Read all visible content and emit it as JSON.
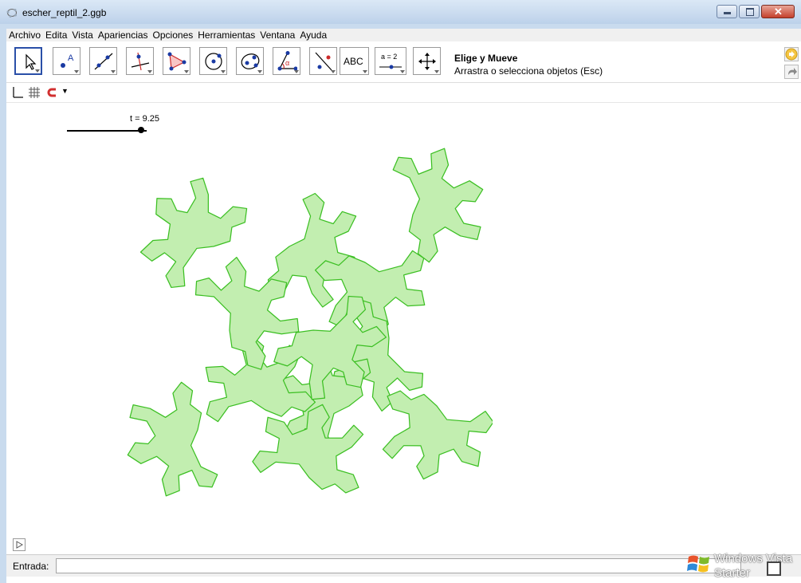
{
  "window": {
    "title": "escher_reptil_2.ggb"
  },
  "menu": [
    "Archivo",
    "Edita",
    "Vista",
    "Apariencias",
    "Opciones",
    "Herramientas",
    "Ventana",
    "Ayuda"
  ],
  "toolbar": {
    "tools": [
      "move",
      "point",
      "line",
      "perpendicular",
      "polygon",
      "circle",
      "conic",
      "angle",
      "reflect",
      "text",
      "slider",
      "move-graphics"
    ],
    "selected_tool_name": "Elige y Mueve",
    "selected_tool_help": "Arrastra o selecciona objetos (Esc)",
    "text_tool_label": "ABC",
    "slider_tool_label": "a = 2"
  },
  "graphics": {
    "slider_label": "t = 9.25",
    "slider_value": 9.25,
    "shape_fill": "#c2eeb0",
    "shape_stroke": "#3bbf22"
  },
  "input": {
    "label": "Entrada:",
    "value": ""
  },
  "watermark": {
    "line1": "Windows Vista",
    "line2": "Starter"
  },
  "colors": {
    "titlebar": "#c9dbee",
    "menubar": "#f0f0f0",
    "accent": "#2a4fa8"
  }
}
